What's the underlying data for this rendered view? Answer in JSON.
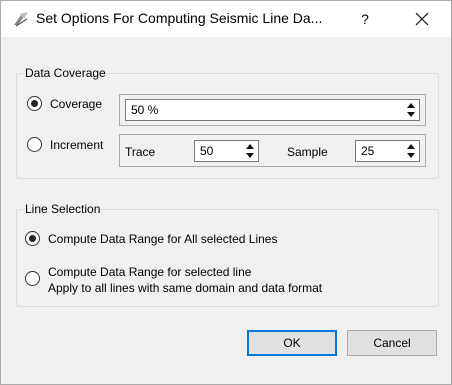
{
  "window": {
    "title": "Set Options For Computing Seismic Line Da...",
    "help_label": "?"
  },
  "data_coverage": {
    "group_title": "Data Coverage",
    "coverage": {
      "label": "Coverage",
      "selected": true,
      "value": "50 %"
    },
    "increment": {
      "label": "Increment",
      "selected": false,
      "trace_label": "Trace",
      "trace_value": "50",
      "sample_label": "Sample",
      "sample_value": "25"
    }
  },
  "line_selection": {
    "group_title": "Line Selection",
    "all_lines": {
      "label": "Compute Data Range for All selected Lines",
      "selected": true
    },
    "selected_line": {
      "label": "Compute Data Range for selected line",
      "sublabel": "Apply to all lines with same domain and data format",
      "selected": false
    }
  },
  "buttons": {
    "ok": "OK",
    "cancel": "Cancel"
  },
  "icons": [
    "app-icon",
    "help-icon",
    "close-icon",
    "spin-up-icon",
    "spin-down-icon"
  ],
  "colors": {
    "accent": "#0078d7",
    "title_bg": "#ffffff",
    "dialog_bg": "#f0f0f0"
  }
}
